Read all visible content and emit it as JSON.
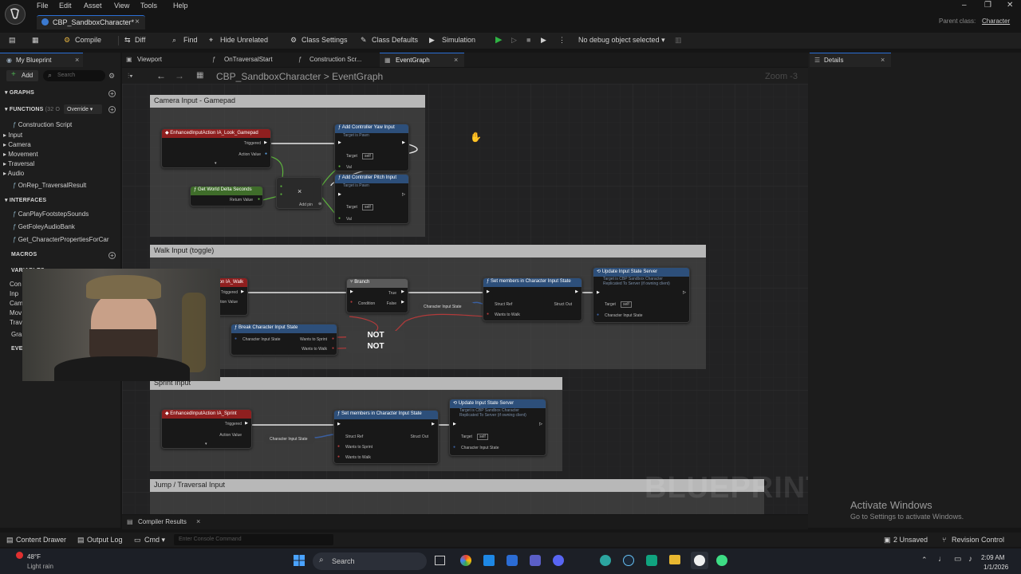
{
  "window": {
    "menu": [
      "File",
      "Edit",
      "Asset",
      "View",
      "Tools",
      "Help"
    ],
    "doc_tab": "CBP_SandboxCharacter*",
    "parent_class_label": "Parent class:",
    "parent_class_value": "Character"
  },
  "toolbar": {
    "compile": "Compile",
    "diff": "Diff",
    "find": "Find",
    "hide_unrelated": "Hide Unrelated",
    "class_settings": "Class Settings",
    "class_defaults": "Class Defaults",
    "simulation": "Simulation",
    "debug_select": "No debug object selected"
  },
  "my_blueprint": {
    "tab": "My Blueprint",
    "add": "Add",
    "search_placeholder": "Search",
    "sections": {
      "graphs": "GRAPHS",
      "functions": "FUNCTIONS",
      "functions_count": "(32 O",
      "override": "Override",
      "interfaces": "INTERFACES",
      "macros": "MACROS",
      "variables": "VARIABLES"
    },
    "functions": [
      "Construction Script",
      "Input",
      "Camera",
      "Movement",
      "Traversal",
      "Audio",
      "OnRep_TraversalResult"
    ],
    "interfaces": [
      "CanPlayFootstepSounds",
      "GetFoleyAudioBank",
      "Get_CharacterPropertiesForCar"
    ],
    "variables_partial": [
      "Con",
      "Inp",
      "Cam",
      "Mov",
      "Trav",
      "Gra",
      "EVE"
    ]
  },
  "graph_tabs": [
    "Viewport",
    "OnTraversalStart",
    "Construction Scr...",
    "EventGraph"
  ],
  "breadcrumb": {
    "root": "CBP_SandboxCharacter",
    "sep": ">",
    "current": "EventGraph"
  },
  "zoom": "Zoom -3",
  "watermark": "BLUEPRINT",
  "comments": {
    "camera": "Camera Input - Gamepad",
    "walk": "Walk Input (toggle)",
    "sprint": "Sprint Input",
    "jump": "Jump / Traversal Input"
  },
  "nodes": {
    "look": {
      "title": "EnhancedInputAction IA_Look_Gamepad",
      "pins": [
        "Triggered",
        "Action Value"
      ]
    },
    "yaw": {
      "title": "Add Controller Yaw Input",
      "sub": "Target is Pawn",
      "pins": [
        "Target",
        "self",
        "Val"
      ]
    },
    "pitch": {
      "title": "Add Controller Pitch Input",
      "sub": "Target is Pawn",
      "pins": [
        "Target",
        "self",
        "Val"
      ]
    },
    "delta": {
      "title": "Get World Delta Seconds",
      "pins": [
        "Return Value"
      ]
    },
    "mult": {
      "op": "×",
      "add_pin": "Add pin"
    },
    "walk_evt": {
      "title": "IA_Walk",
      "pins": [
        "Triggered",
        "Action Value"
      ]
    },
    "branch": {
      "title": "Branch",
      "pins": [
        "Condition",
        "True",
        "False"
      ]
    },
    "set_members": {
      "title": "Set members in Character Input State",
      "pins": [
        "Struct Ref",
        "Struct Out",
        "Wants to Walk"
      ]
    },
    "update_state": {
      "title": "Update Input State Server",
      "sub": "Target is CBP Sandbox Character",
      "sub2": "Replicated To Server (if owning client)",
      "pins": [
        "Target",
        "self",
        "Character Input State"
      ]
    },
    "break_state": {
      "title": "Break Character Input State",
      "pins": [
        "Character Input State",
        "Wants to Sprint",
        "Wants to Walk"
      ]
    },
    "not1": "NOT",
    "not2": "NOT",
    "var_state": "Character Input State",
    "sprint_evt": {
      "title": "EnhancedInputAction IA_Sprint",
      "pins": [
        "Triggered",
        "Action Value"
      ]
    },
    "sprint_set": {
      "title": "Set members in Character Input State",
      "pins": [
        "Struct Ref",
        "Struct Out",
        "Wants to Sprint",
        "Wants to Walk"
      ]
    },
    "sprint_update": {
      "title": "Update Input State Server",
      "sub": "Target is CBP Sandbox Character",
      "sub2": "Replicated To Server (if owning client)",
      "pins": [
        "Target",
        "self",
        "Character Input State"
      ]
    },
    "sprint_var": "Character Input State"
  },
  "details": {
    "tab": "Details"
  },
  "activate_windows": {
    "title": "Activate Windows",
    "sub": "Go to Settings to activate Windows."
  },
  "bottom": {
    "compiler_results": "Compiler Results",
    "content_drawer": "Content Drawer",
    "output_log": "Output Log",
    "cmd": "Cmd",
    "console_placeholder": "Enter Console Command",
    "unsaved": "2 Unsaved",
    "revision": "Revision Control"
  },
  "taskbar": {
    "weather_temp": "48°F",
    "weather_desc": "Light rain",
    "search": "Search",
    "time": "2:09 AM",
    "date": "1/1/2026"
  },
  "colors": {
    "accent": "#2a6fd6",
    "event_red": "#8f1f1f",
    "func_blue": "#2d4f7a",
    "pure_green": "#3f6d2a",
    "comment_header": "#b8b8b8",
    "play_green": "#2fb344"
  }
}
